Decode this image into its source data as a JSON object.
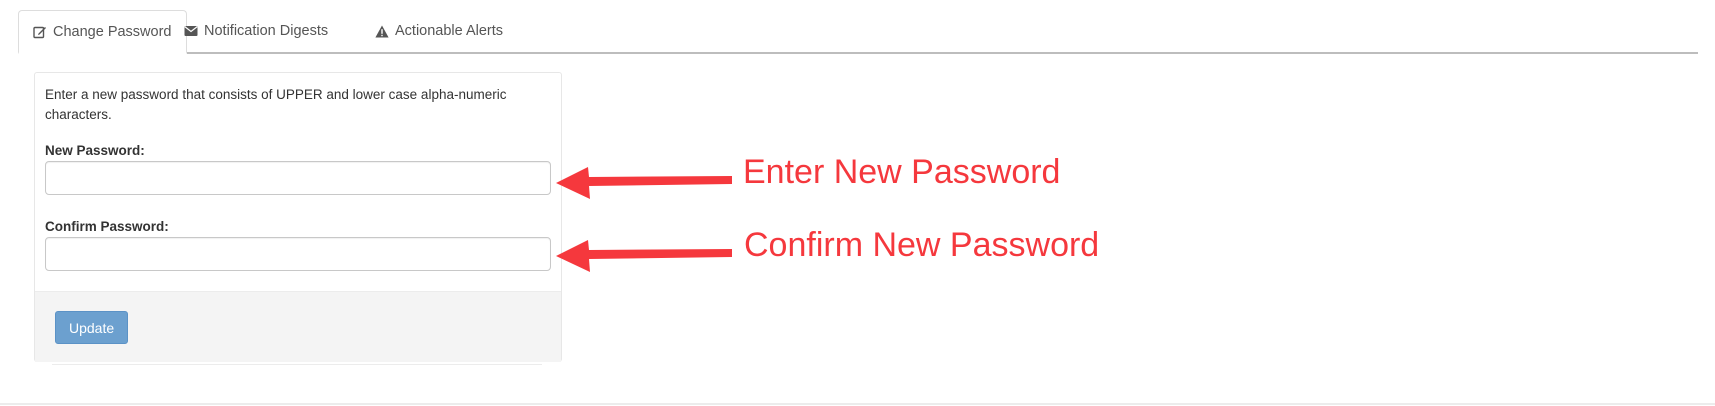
{
  "tabs": [
    {
      "label": "Change Password",
      "icon": "edit-icon",
      "active": true
    },
    {
      "label": "Notification Digests",
      "icon": "envelope-icon",
      "active": false
    },
    {
      "label": "Actionable Alerts",
      "icon": "warning-icon",
      "active": false
    }
  ],
  "form": {
    "intro": "Enter a new password that consists of UPPER and lower case alpha-numeric characters.",
    "new_password_label": "New Password:",
    "new_password_value": "",
    "confirm_password_label": "Confirm Password:",
    "confirm_password_value": "",
    "update_label": "Update"
  },
  "annotations": {
    "enter_new": "Enter New Password",
    "confirm_new": "Confirm New Password"
  },
  "colors": {
    "annotation": "#f5383d",
    "button": "#6ca0cf",
    "footer": "#f4f4f4"
  }
}
